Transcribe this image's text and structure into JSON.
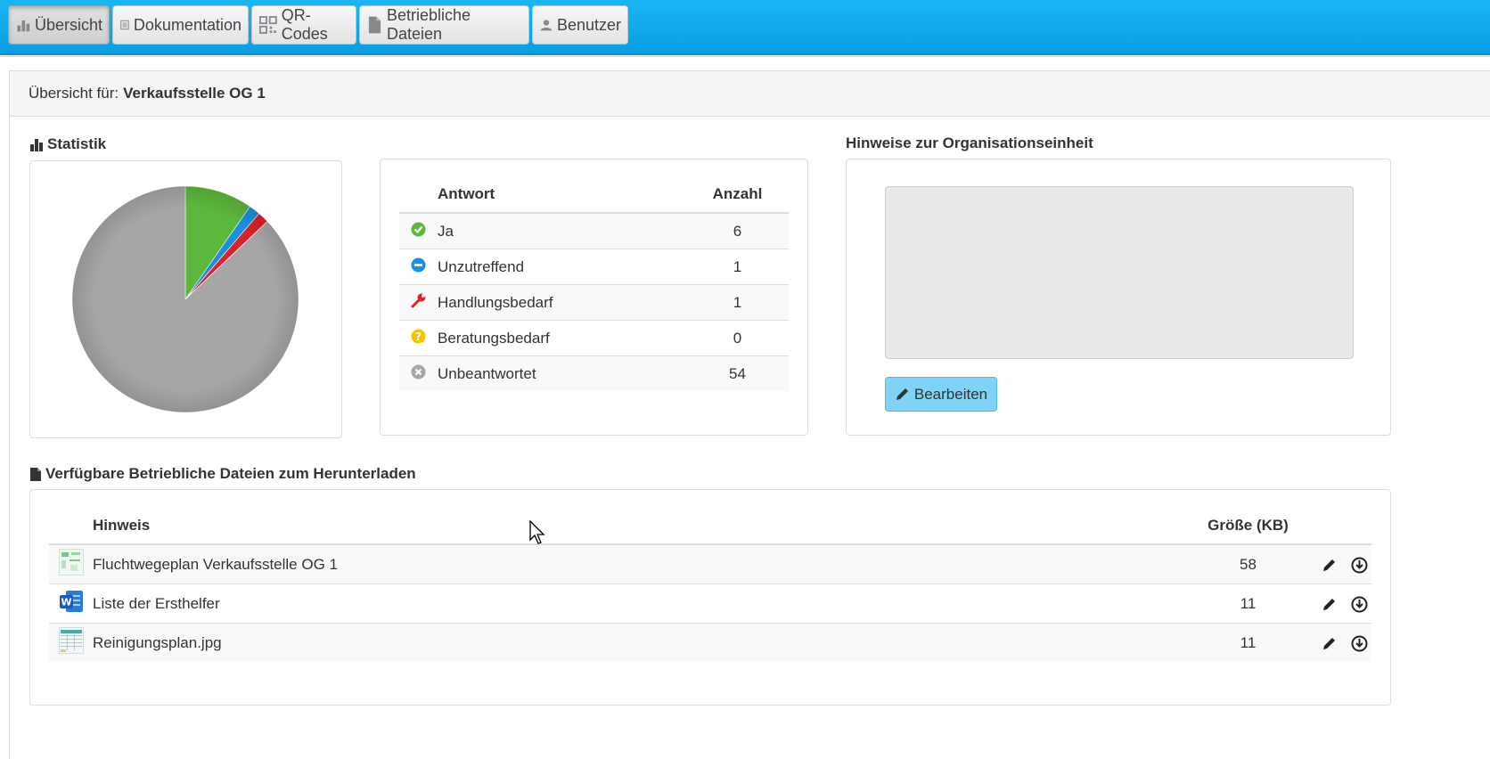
{
  "nav": {
    "tabs": [
      {
        "label": "Übersicht",
        "icon": "bar-chart-icon",
        "active": true
      },
      {
        "label": "Dokumentation",
        "icon": "list-document-icon"
      },
      {
        "label": "QR-Codes",
        "icon": "qr-code-icon"
      },
      {
        "label": "Betriebliche Dateien",
        "icon": "file-icon"
      },
      {
        "label": "Benutzer",
        "icon": "user-icon"
      }
    ]
  },
  "overview": {
    "label": "Übersicht für:",
    "unit": "Verkaufsstelle OG 1"
  },
  "statistik": {
    "title": "Statistik",
    "header_answer": "Antwort",
    "header_count": "Anzahl",
    "rows": [
      {
        "label": "Ja",
        "count": "6",
        "icon": "check-circle-icon",
        "color": "#5cb83c"
      },
      {
        "label": "Unzutreffend",
        "count": "1",
        "icon": "minus-circle-icon",
        "color": "#1a8fde"
      },
      {
        "label": "Handlungsbedarf",
        "count": "1",
        "icon": "wrench-icon",
        "color": "#d9222a"
      },
      {
        "label": "Beratungsbedarf",
        "count": "0",
        "icon": "question-circle-icon",
        "color": "#f5c400"
      },
      {
        "label": "Unbeantwortet",
        "count": "54",
        "icon": "x-circle-icon",
        "color": "#a6a6a6"
      }
    ]
  },
  "chart_data": {
    "type": "pie",
    "categories": [
      "Ja",
      "Unzutreffend",
      "Handlungsbedarf",
      "Beratungsbedarf",
      "Unbeantwortet"
    ],
    "values": [
      6,
      1,
      1,
      0,
      54
    ],
    "colors": [
      "#5cb83c",
      "#1a8fde",
      "#d9222a",
      "#f5c400",
      "#a6a6a6"
    ]
  },
  "hinweise": {
    "title": "Hinweise zur Organisationseinheit",
    "edit_label": "Bearbeiten"
  },
  "dateien": {
    "title": "Verfügbare Betriebliche Dateien zum Herunterladen",
    "header_hint": "Hinweis",
    "header_size": "Größe (KB)",
    "rows": [
      {
        "name": "Fluchtwegeplan Verkaufsstelle OG 1",
        "size": "58",
        "icon": "image-thumbnail-icon"
      },
      {
        "name": "Liste der Ersthelfer",
        "size": "11",
        "icon": "word-document-icon"
      },
      {
        "name": "Reinigungsplan.jpg",
        "size": "11",
        "icon": "spreadsheet-thumbnail-icon"
      }
    ]
  }
}
